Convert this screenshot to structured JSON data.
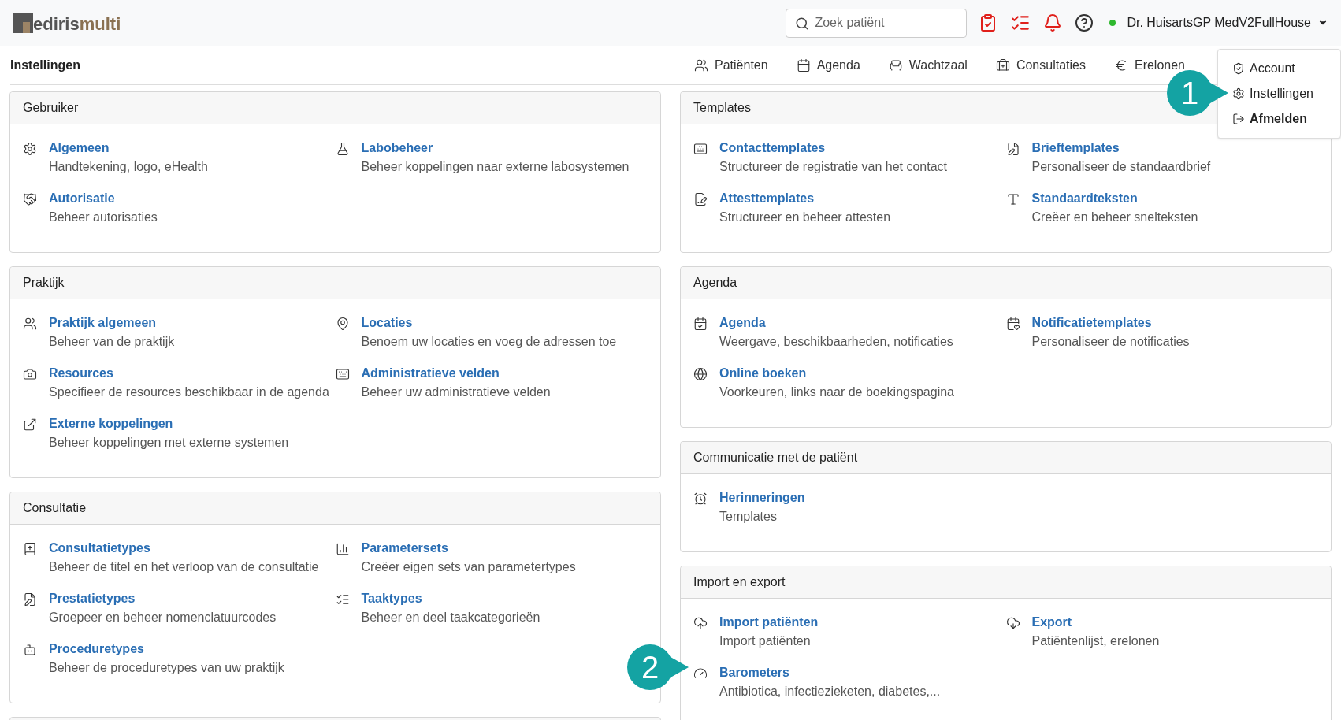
{
  "header": {
    "logo": {
      "part_1": "ediris",
      "part_2": "multi"
    },
    "search": {
      "placeholder": "Zoek patiënt"
    },
    "user": {
      "name": "Dr. HuisartsGP MedV2FullHouse",
      "online": true
    }
  },
  "page_title": "Instellingen",
  "nav": [
    {
      "label": "Patiënten"
    },
    {
      "label": "Agenda"
    },
    {
      "label": "Wachtzaal"
    },
    {
      "label": "Consultaties"
    },
    {
      "label": "Erelonen"
    }
  ],
  "user_menu": [
    {
      "label": "Account",
      "bold": false
    },
    {
      "label": "Instellingen",
      "bold": false
    },
    {
      "label": "Afmelden",
      "bold": true
    }
  ],
  "columns": [
    [
      {
        "title": "Gebruiker",
        "items": [
          {
            "title": "Algemeen",
            "description": "Handtekening, logo, eHealth"
          },
          {
            "title": "Labobeheer",
            "description": "Beheer koppelingen naar externe labosystemen"
          },
          {
            "title": "Autorisatie",
            "description": "Beheer autorisaties"
          }
        ]
      },
      {
        "title": "Praktijk",
        "items": [
          {
            "title": "Praktijk algemeen",
            "description": "Beheer van de praktijk"
          },
          {
            "title": "Locaties",
            "description": "Benoem uw locaties en voeg de adressen toe"
          },
          {
            "title": "Resources",
            "description": "Specifieer de resources beschikbaar in de agenda"
          },
          {
            "title": "Administratieve velden",
            "description": "Beheer uw administratieve velden"
          },
          {
            "title": "Externe koppelingen",
            "description": "Beheer koppelingen met externe systemen"
          }
        ]
      },
      {
        "title": "Consultatie",
        "items": [
          {
            "title": "Consultatietypes",
            "description": "Beheer de titel en het verloop van de consultatie"
          },
          {
            "title": "Parametersets",
            "description": "Creëer eigen sets van parametertypes"
          },
          {
            "title": "Prestatietypes",
            "description": "Groepeer en beheer nomenclatuurcodes"
          },
          {
            "title": "Taaktypes",
            "description": "Beheer en deel taakcategorieën"
          },
          {
            "title": "Proceduretypes",
            "description": "Beheer de proceduretypes van uw praktijk"
          }
        ]
      }
    ],
    [
      {
        "title": "Templates",
        "items": [
          {
            "title": "Contacttemplates",
            "description": "Structureer de registratie van het contact"
          },
          {
            "title": "Brieftemplates",
            "description": "Personaliseer de standaardbrief"
          },
          {
            "title": "Attesttemplates",
            "description": "Structureer en beheer attesten"
          },
          {
            "title": "Standaardteksten",
            "description": "Creëer en beheer snelteksten"
          }
        ]
      },
      {
        "title": "Agenda",
        "items": [
          {
            "title": "Agenda",
            "description": "Weergave, beschikbaarheden, notificaties"
          },
          {
            "title": "Notificatietemplates",
            "description": "Personaliseer de notificaties"
          },
          {
            "title": "Online boeken",
            "description": "Voorkeuren, links naar de boekingspagina"
          }
        ]
      },
      {
        "title": "Communicatie met de patiënt",
        "items": [
          {
            "title": "Herinneringen",
            "description": "Templates"
          }
        ]
      },
      {
        "title": "Import en export",
        "items": [
          {
            "title": "Import patiënten",
            "description": "Import patiënten"
          },
          {
            "title": "Export",
            "description": "Patiëntenlijst, erelonen"
          },
          {
            "title": "Barometers",
            "description": "Antibiotica, infectiezieketen, diabetes,..."
          }
        ]
      }
    ]
  ],
  "callouts": [
    {
      "label": "1"
    },
    {
      "label": "2"
    }
  ]
}
